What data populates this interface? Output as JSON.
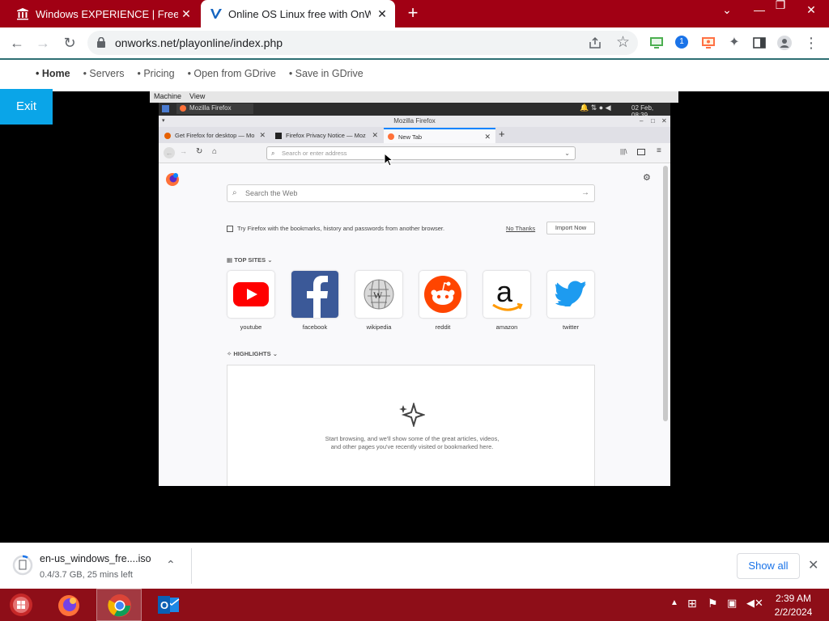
{
  "chrome": {
    "tabs": [
      {
        "title": "Windows EXPERIENCE | Freestyle",
        "active": false
      },
      {
        "title": "Online OS Linux free with OnWorks",
        "active": true
      }
    ],
    "url": "onworks.net/playonline/index.php",
    "extension_badge": "1"
  },
  "site": {
    "nav": [
      "• Home",
      "• Servers",
      "• Pricing",
      "• Open from GDrive",
      "• Save in GDrive"
    ],
    "exit_label": "Exit"
  },
  "vm": {
    "menu": [
      "Machine",
      "View"
    ],
    "panel_app": "Mozilla Firefox",
    "panel_datetime": "02 Feb, 08:39",
    "firefox": {
      "window_title": "Mozilla Firefox",
      "tabs": [
        {
          "title": "Get Firefox for desktop — Mo"
        },
        {
          "title": "Firefox Privacy Notice — Moz"
        },
        {
          "title": "New Tab"
        }
      ],
      "url_placeholder": "Search or enter address",
      "search_placeholder": "Search the Web",
      "import_text": "Try Firefox with the bookmarks, history and passwords from another browser.",
      "no_thanks": "No Thanks",
      "import_now": "Import Now",
      "top_sites_label": "TOP SITES",
      "top_sites": [
        "youtube",
        "facebook",
        "wikipedia",
        "reddit",
        "amazon",
        "twitter"
      ],
      "highlights_label": "HIGHLIGHTS",
      "highlights_empty": "Start browsing, and we'll show some of the great articles, videos, and other pages you've recently visited or bookmarked here."
    }
  },
  "download": {
    "filename": "en-us_windows_fre....iso",
    "status": "0.4/3.7 GB, 25 mins left",
    "show_all": "Show all"
  },
  "taskbar": {
    "time": "2:39 AM",
    "date": "2/2/2024"
  },
  "colors": {
    "tabstrip": "#a10014",
    "taskbar": "#8e0e18",
    "exit_button": "#0aa5e8",
    "link_blue": "#1a73e8"
  }
}
